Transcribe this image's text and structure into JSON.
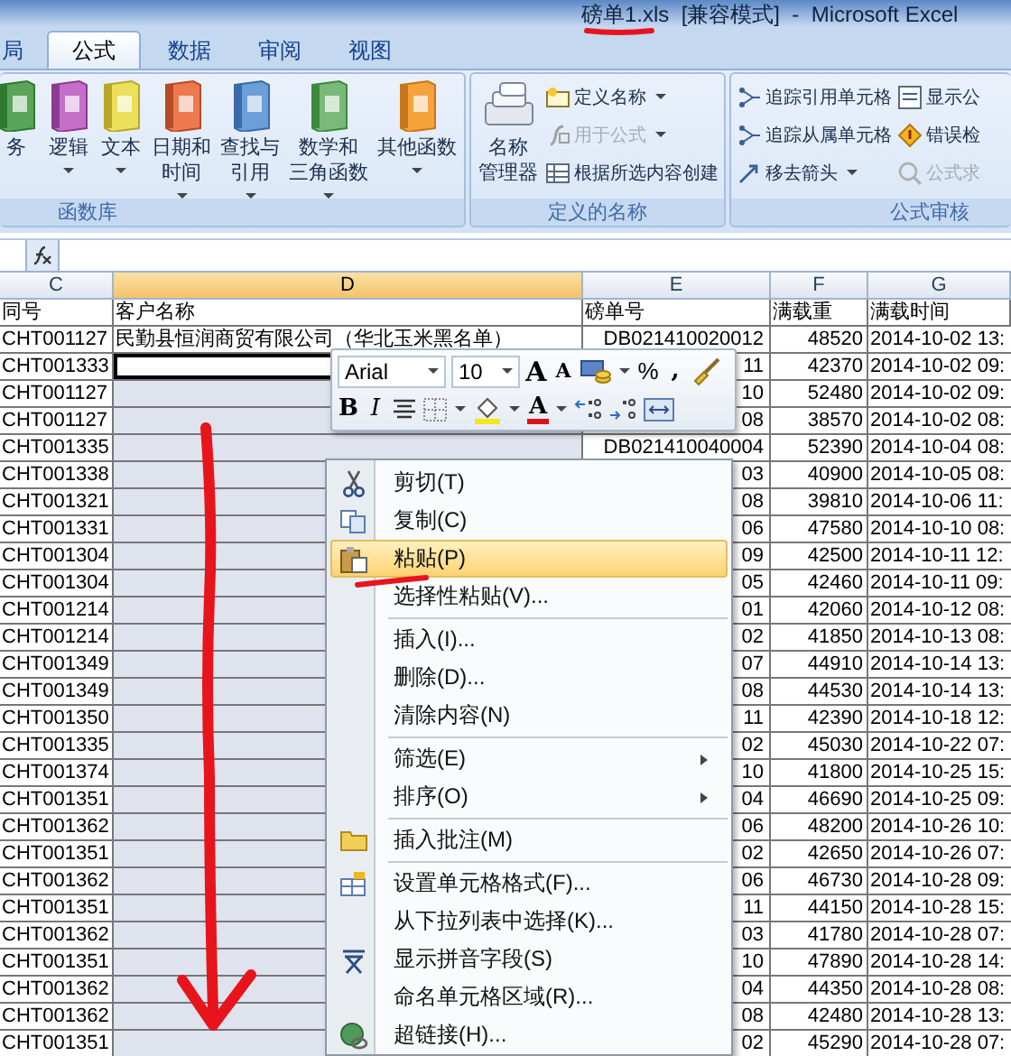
{
  "window": {
    "title": "磅单1.xls  [兼容模式]  -  Microsoft Excel"
  },
  "ribbon_tabs": [
    {
      "label": "局",
      "selected": false
    },
    {
      "label": "公式",
      "selected": true
    },
    {
      "label": "数据",
      "selected": false
    },
    {
      "label": "审阅",
      "selected": false
    },
    {
      "label": "视图",
      "selected": false
    }
  ],
  "ribbon_groups": [
    {
      "label": "函数库",
      "large": [
        {
          "lines": [
            "务"
          ],
          "dropdown": false
        },
        {
          "lines": [
            "逻辑"
          ],
          "dropdown": true
        },
        {
          "lines": [
            "文本"
          ],
          "dropdown": true
        },
        {
          "lines": [
            "日期和",
            "时间"
          ],
          "dropdown": true
        },
        {
          "lines": [
            "查找与",
            "引用"
          ],
          "dropdown": true
        },
        {
          "lines": [
            "数学和",
            "三角函数"
          ],
          "dropdown": true
        },
        {
          "lines": [
            "其他函数"
          ],
          "dropdown": true
        }
      ]
    },
    {
      "label": "定义的名称",
      "large": [
        {
          "lines": [
            "名称",
            "管理器"
          ],
          "dropdown": false
        }
      ],
      "small_columns": [
        [
          {
            "label": "定义名称",
            "dropdown": true,
            "disabled": false
          },
          {
            "label": "用于公式",
            "dropdown": true,
            "disabled": true
          },
          {
            "label": "根据所选内容创建",
            "dropdown": false,
            "disabled": false
          }
        ]
      ]
    },
    {
      "label": "公式审核",
      "small_columns": [
        [
          {
            "label": "追踪引用单元格",
            "dropdown": false,
            "disabled": false
          },
          {
            "label": "追踪从属单元格",
            "dropdown": false,
            "disabled": false
          },
          {
            "label": "移去箭头",
            "dropdown": true,
            "disabled": false
          }
        ],
        [
          {
            "label": "显示公",
            "dropdown": false,
            "disabled": false
          },
          {
            "label": "错误检",
            "dropdown": false,
            "disabled": false
          },
          {
            "label": "公式求",
            "dropdown": false,
            "disabled": true
          }
        ]
      ]
    }
  ],
  "sheet": {
    "columns": [
      {
        "letter": "C",
        "selected": false
      },
      {
        "letter": "D",
        "selected": true
      },
      {
        "letter": "E",
        "selected": false
      },
      {
        "letter": "F",
        "selected": false
      },
      {
        "letter": "G",
        "selected": false
      }
    ],
    "header_row": [
      "同号",
      "客户名称",
      "磅单号",
      "满载重",
      "满载时间"
    ],
    "rows": [
      {
        "c": "CHT001127",
        "d": "民勤县恒润商贸有限公司（华北玉米黑名单）",
        "e": "DB021410020012",
        "f": "48520",
        "g": "2014-10-02 13:",
        "selected": false,
        "active": false
      },
      {
        "c": "CHT001333",
        "e": "11",
        "f": "42370",
        "g": "2014-10-02 09:",
        "selected": true,
        "active": true
      },
      {
        "c": "CHT001127",
        "e": "10",
        "f": "52480",
        "g": "2014-10-02 09:",
        "selected": true,
        "active": false
      },
      {
        "c": "CHT001127",
        "e": "08",
        "f": "38570",
        "g": "2014-10-02 08:",
        "selected": true,
        "active": false
      },
      {
        "c": "CHT001335",
        "e": "DB021410040004",
        "f": "52390",
        "g": "2014-10-04 08:",
        "selected": true,
        "active": false
      },
      {
        "c": "CHT001338",
        "e": "03",
        "f": "40900",
        "g": "2014-10-05 08:",
        "selected": true,
        "active": false
      },
      {
        "c": "CHT001321",
        "e": "08",
        "f": "39810",
        "g": "2014-10-06 11:",
        "selected": true,
        "active": false
      },
      {
        "c": "CHT001331",
        "e": "06",
        "f": "47580",
        "g": "2014-10-10 08:",
        "selected": true,
        "active": false
      },
      {
        "c": "CHT001304",
        "e": "09",
        "f": "42500",
        "g": "2014-10-11 12:",
        "selected": true,
        "active": false
      },
      {
        "c": "CHT001304",
        "e": "05",
        "f": "42460",
        "g": "2014-10-11 09:",
        "selected": true,
        "active": false
      },
      {
        "c": "CHT001214",
        "e": "01",
        "f": "42060",
        "g": "2014-10-12 08:",
        "selected": true,
        "active": false
      },
      {
        "c": "CHT001214",
        "e": "02",
        "f": "41850",
        "g": "2014-10-13 08:",
        "selected": true,
        "active": false
      },
      {
        "c": "CHT001349",
        "e": "07",
        "f": "44910",
        "g": "2014-10-14 13:",
        "selected": true,
        "active": false
      },
      {
        "c": "CHT001349",
        "e": "08",
        "f": "44530",
        "g": "2014-10-14 13:",
        "selected": true,
        "active": false
      },
      {
        "c": "CHT001350",
        "e": "11",
        "f": "42390",
        "g": "2014-10-18 12:",
        "selected": true,
        "active": false
      },
      {
        "c": "CHT001335",
        "e": "02",
        "f": "45030",
        "g": "2014-10-22 07:",
        "selected": true,
        "active": false
      },
      {
        "c": "CHT001374",
        "e": "10",
        "f": "41800",
        "g": "2014-10-25 15:",
        "selected": true,
        "active": false
      },
      {
        "c": "CHT001351",
        "e": "04",
        "f": "46690",
        "g": "2014-10-25 09:",
        "selected": true,
        "active": false
      },
      {
        "c": "CHT001362",
        "e": "06",
        "f": "48200",
        "g": "2014-10-26 10:",
        "selected": true,
        "active": false
      },
      {
        "c": "CHT001351",
        "e": "02",
        "f": "42650",
        "g": "2014-10-26 07:",
        "selected": true,
        "active": false
      },
      {
        "c": "CHT001362",
        "e": "06",
        "f": "46730",
        "g": "2014-10-28 09:",
        "selected": true,
        "active": false
      },
      {
        "c": "CHT001351",
        "e": "11",
        "f": "44150",
        "g": "2014-10-28 15:",
        "selected": true,
        "active": false
      },
      {
        "c": "CHT001362",
        "e": "03",
        "f": "41780",
        "g": "2014-10-28 07:",
        "selected": true,
        "active": false
      },
      {
        "c": "CHT001351",
        "e": "10",
        "f": "47890",
        "g": "2014-10-28 14:",
        "selected": true,
        "active": false
      },
      {
        "c": "CHT001362",
        "e": "04",
        "f": "44350",
        "g": "2014-10-28 08:",
        "selected": true,
        "active": false
      },
      {
        "c": "CHT001362",
        "e": "08",
        "f": "42480",
        "g": "2014-10-28 13:",
        "selected": true,
        "active": false
      },
      {
        "c": "CHT001351",
        "e": "02",
        "f": "45290",
        "g": "2014-10-28 07:",
        "selected": true,
        "active": false
      }
    ]
  },
  "mini_toolbar": {
    "font": "Arial",
    "size": "10",
    "grow_font": "A",
    "shrink_font": "A",
    "percent": "%",
    "comma": ",",
    "bold": "B",
    "italic": "I",
    "font_color": "A"
  },
  "context_menu": [
    {
      "label": "剪切(T)",
      "selected": false,
      "submenu": false,
      "separator_before": false
    },
    {
      "label": "复制(C)",
      "selected": false,
      "submenu": false,
      "separator_before": false
    },
    {
      "label": "粘贴(P)",
      "selected": true,
      "submenu": false,
      "separator_before": false
    },
    {
      "label": "选择性粘贴(V)...",
      "selected": false,
      "submenu": false,
      "separator_before": false
    },
    {
      "label": "插入(I)...",
      "selected": false,
      "submenu": false,
      "separator_before": true
    },
    {
      "label": "删除(D)...",
      "selected": false,
      "submenu": false,
      "separator_before": false
    },
    {
      "label": "清除内容(N)",
      "selected": false,
      "submenu": false,
      "separator_before": false
    },
    {
      "label": "筛选(E)",
      "selected": false,
      "submenu": true,
      "separator_before": true
    },
    {
      "label": "排序(O)",
      "selected": false,
      "submenu": true,
      "separator_before": false
    },
    {
      "label": "插入批注(M)",
      "selected": false,
      "submenu": false,
      "separator_before": true
    },
    {
      "label": "设置单元格格式(F)...",
      "selected": false,
      "submenu": false,
      "separator_before": true
    },
    {
      "label": "从下拉列表中选择(K)...",
      "selected": false,
      "submenu": false,
      "separator_before": false
    },
    {
      "label": "显示拼音字段(S)",
      "selected": false,
      "submenu": false,
      "separator_before": false
    },
    {
      "label": "命名单元格区域(R)...",
      "selected": false,
      "submenu": false,
      "separator_before": false
    },
    {
      "label": "超链接(H)...",
      "selected": false,
      "submenu": false,
      "separator_before": false
    }
  ]
}
